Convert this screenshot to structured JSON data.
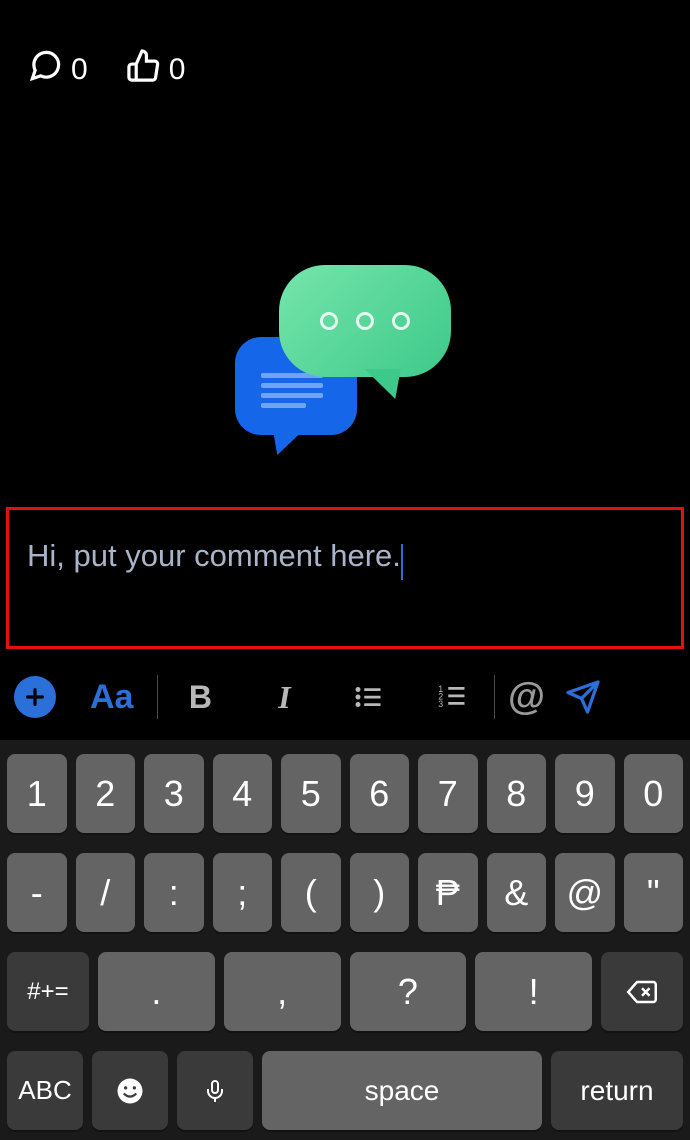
{
  "stats": {
    "comments": "0",
    "likes": "0"
  },
  "comment": {
    "text": "Hi, put your comment here."
  },
  "toolbar": {
    "aa_label": "Aa",
    "bold_label": "B",
    "italic_label": "I",
    "mention_label": "@"
  },
  "keyboard": {
    "row1": [
      "1",
      "2",
      "3",
      "4",
      "5",
      "6",
      "7",
      "8",
      "9",
      "0"
    ],
    "row2": [
      "-",
      "/",
      ":",
      ";",
      "(",
      ")",
      "₱",
      "&",
      "@",
      "\""
    ],
    "row3": {
      "sym": "#+=",
      "keys": [
        ".",
        ",",
        "?",
        "!"
      ]
    },
    "row4": {
      "abc": "ABC",
      "space": "space",
      "return": "return"
    }
  }
}
